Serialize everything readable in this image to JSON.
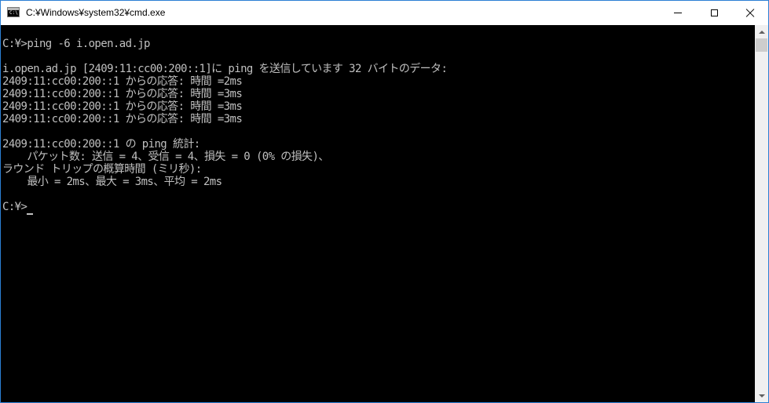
{
  "window": {
    "title": "C:¥Windows¥system32¥cmd.exe",
    "icon_text": "C:\\",
    "icon": "cmd-icon",
    "minimize_icon": "minimize-icon",
    "maximize_icon": "maximize-icon",
    "close_icon": "close-icon"
  },
  "console": {
    "lines": [
      "C:¥>ping -6 i.open.ad.jp",
      "",
      "i.open.ad.jp [2409:11:cc00:200::1]に ping を送信しています 32 バイトのデータ:",
      "2409:11:cc00:200::1 からの応答: 時間 =2ms",
      "2409:11:cc00:200::1 からの応答: 時間 =3ms",
      "2409:11:cc00:200::1 からの応答: 時間 =3ms",
      "2409:11:cc00:200::1 からの応答: 時間 =3ms",
      "",
      "2409:11:cc00:200::1 の ping 統計:",
      "    パケット数: 送信 = 4、受信 = 4、損失 = 0 (0% の損失)、",
      "ラウンド トリップの概算時間 (ミリ秒):",
      "    最小 = 2ms、最大 = 3ms、平均 = 2ms",
      "",
      "C:¥>"
    ]
  },
  "colors": {
    "console_background": "#000000",
    "console_text": "#c0c0c0",
    "window_border": "#2b7fd4"
  }
}
